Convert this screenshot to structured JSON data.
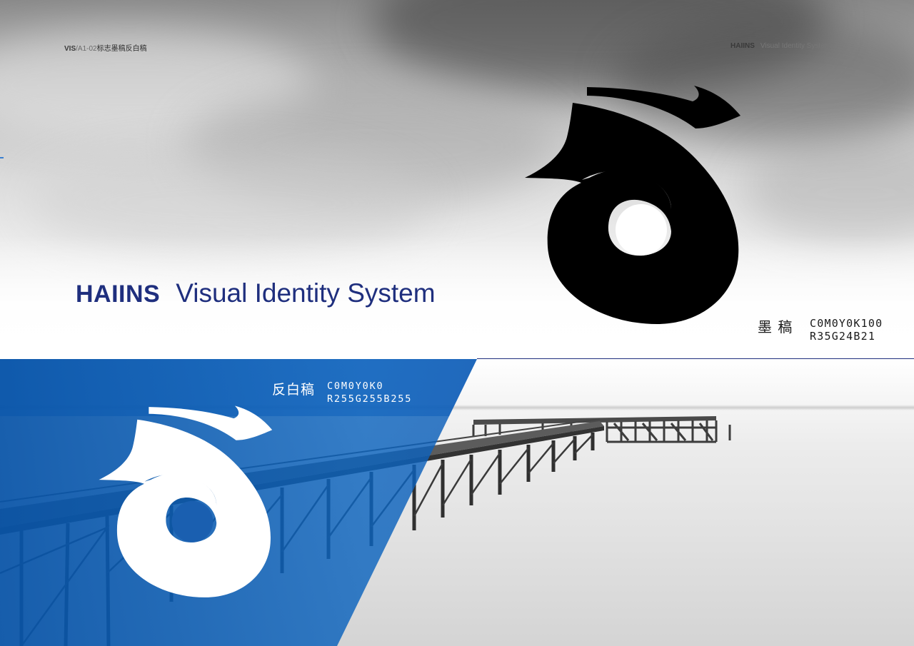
{
  "header": {
    "left_code_bold": "VIS",
    "left_code_rest": "/A1-02",
    "left_title": "标志墨稿反白稿",
    "right_brand": "HAIINS",
    "right_subtitle": "Visual Identity System"
  },
  "title": {
    "brand": "HAIINS",
    "subtitle": "Visual Identity System"
  },
  "mono_version": {
    "label": "墨  稿",
    "cmyk": "C0M0Y0K100",
    "rgb": "R35G24B21",
    "color": "#231815"
  },
  "reverse_version": {
    "label": "反白稿",
    "cmyk": "C0M0Y0K0",
    "rgb": "R255G255B255",
    "color": "#ffffff"
  },
  "colors": {
    "brand_navy": "#1f2f7e",
    "overlay_blue": "#0854a8"
  },
  "icons": {
    "logo_mark": "stylized-rooster-spiral-logo"
  }
}
